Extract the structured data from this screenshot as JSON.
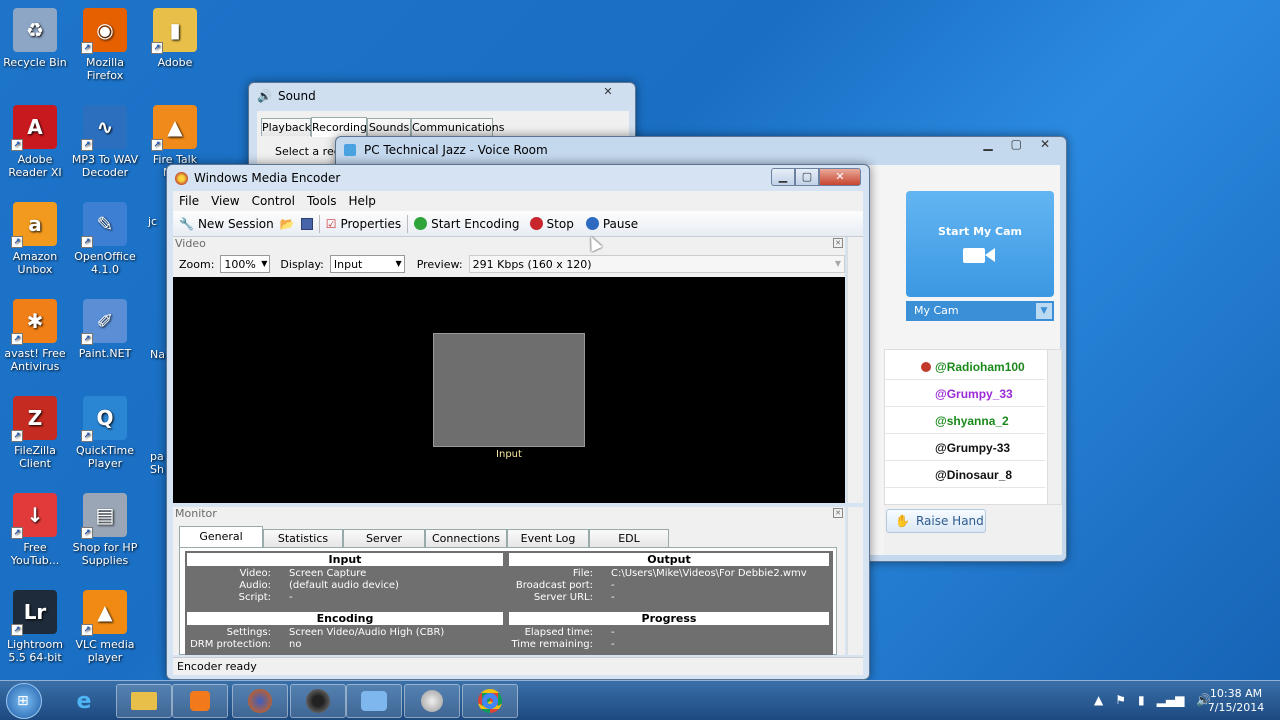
{
  "desktop_icons": [
    {
      "label": "Recycle Bin",
      "icon": "recycle-bin-icon",
      "color": "#8da6c6",
      "glyph": "♻"
    },
    {
      "label": "Mozilla Firefox",
      "icon": "firefox-icon",
      "color": "#e66000",
      "glyph": "◉"
    },
    {
      "label": "Adobe",
      "icon": "folder-icon",
      "color": "#e8c049",
      "glyph": "▮"
    },
    {
      "label": "Adobe Reader XI",
      "icon": "adobe-reader-icon",
      "color": "#c8191f",
      "glyph": "A"
    },
    {
      "label": "MP3 To WAV Decoder",
      "icon": "audio-wave-icon",
      "color": "#2c6fbf",
      "glyph": "∿"
    },
    {
      "label": "Fire Talk New",
      "icon": "fire-icon",
      "color": "#f08a1a",
      "glyph": "▲"
    },
    {
      "label": "Amazon Unbox",
      "icon": "amazon-icon",
      "color": "#f29a1e",
      "glyph": "a"
    },
    {
      "label": "OpenOffice 4.1.0",
      "icon": "openoffice-icon",
      "color": "#3c7fd3",
      "glyph": "✎"
    },
    {
      "label": "avast! Free Antivirus",
      "icon": "avast-icon",
      "color": "#f07f18",
      "glyph": "✱"
    },
    {
      "label": "Paint.NET",
      "icon": "paint-icon",
      "color": "#5a8fd6",
      "glyph": "✐"
    },
    {
      "label": "FileZilla Client",
      "icon": "filezilla-icon",
      "color": "#c52b21",
      "glyph": "Z"
    },
    {
      "label": "QuickTime Player",
      "icon": "quicktime-icon",
      "color": "#2a85d3",
      "glyph": "Q"
    },
    {
      "label": "Free YouTub...",
      "icon": "download-icon",
      "color": "#e23a3a",
      "glyph": "↓"
    },
    {
      "label": "Shop for HP Supplies",
      "icon": "printer-icon",
      "color": "#9aa6b5",
      "glyph": "▤"
    },
    {
      "label": "Lightroom 5.5 64-bit",
      "icon": "lightroom-icon",
      "color": "#1e2b3b",
      "glyph": "Lr"
    },
    {
      "label": "VLC media player",
      "icon": "vlc-icon",
      "color": "#f08a12",
      "glyph": "▲"
    }
  ],
  "partial_icons": [
    "jc",
    "Na",
    "pa Sh"
  ],
  "sound_window": {
    "title": "Sound",
    "close": "✕",
    "tabs": [
      "Playback",
      "Recording",
      "Sounds",
      "Communications"
    ],
    "body_text": "Select a reco"
  },
  "voice_room": {
    "title": "PC Technical Jazz - Voice Room",
    "start_cam": "Start My Cam",
    "cam_select": "My Cam",
    "users": [
      {
        "name": "@Radioham100",
        "color": "#1b8a1b",
        "badge": true
      },
      {
        "name": "@Grumpy_33",
        "color": "#9b2bd6",
        "badge": false
      },
      {
        "name": "@shyanna_2",
        "color": "#1b8a1b",
        "badge": false
      },
      {
        "name": "@Grumpy-33",
        "color": "#111111",
        "badge": false
      },
      {
        "name": "@Dinosaur_8",
        "color": "#111111",
        "badge": false
      }
    ],
    "raise_hand": "Raise Hand"
  },
  "wme": {
    "title": "Windows Media Encoder",
    "menu": [
      "File",
      "View",
      "Control",
      "Tools",
      "Help"
    ],
    "toolbar": {
      "new_session": "New Session",
      "properties": "Properties",
      "start": "Start Encoding",
      "stop": "Stop",
      "pause": "Pause"
    },
    "video_panel": "Video",
    "zoom_label": "Zoom:",
    "zoom_value": "100%",
    "display_label": "Display:",
    "display_value": "Input",
    "preview_label": "Preview:",
    "preview_value": "291 Kbps (160 x 120)",
    "input_caption": "Input",
    "monitor_panel": "Monitor",
    "tabs": [
      "General",
      "Statistics",
      "Server",
      "Connections",
      "Event Log",
      "EDL"
    ],
    "input_hdr": "Input",
    "output_hdr": "Output",
    "encoding_hdr": "Encoding",
    "progress_hdr": "Progress",
    "input_rows": [
      [
        "Video:",
        "Screen Capture"
      ],
      [
        "Audio:",
        "(default audio device)"
      ],
      [
        "Script:",
        "-"
      ]
    ],
    "output_rows": [
      [
        "File:",
        "C:\\Users\\Mike\\Videos\\For Debbie2.wmv"
      ],
      [
        "Broadcast port:",
        "-"
      ],
      [
        "Server URL:",
        "-"
      ]
    ],
    "encoding_rows": [
      [
        "Settings:",
        "Screen Video/Audio High (CBR)"
      ],
      [
        "DRM protection:",
        "no"
      ]
    ],
    "progress_rows": [
      [
        "Elapsed time:",
        "-"
      ],
      [
        "Time remaining:",
        "-"
      ]
    ],
    "status": "Encoder ready"
  },
  "taskbar": {
    "time": "10:38 AM",
    "date": "7/15/2014"
  }
}
